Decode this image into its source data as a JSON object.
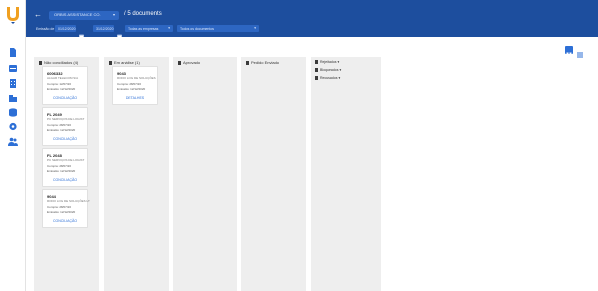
{
  "header": {
    "company": "ORBIS ASSISTANCE CO.",
    "title": "/ 5 documents",
    "filter_label": "Emissão de",
    "date_from": "01/12/2020",
    "to_label": "a",
    "date_to": "31/12/2020",
    "select_one": "Todas as empresas",
    "select_two": "Todos os documentos"
  },
  "columns": [
    {
      "label": "Não conciliados (4)"
    },
    {
      "label": "Em análise (1)"
    },
    {
      "label": "Aprovado"
    },
    {
      "label": "Pedido Enviado"
    }
  ],
  "cards_col1": [
    {
      "title": "6006332",
      "sub": "ALGAR TELECOM S/A",
      "line1": "Compra: 12/07/20",
      "line2": "Emissão: 12/12/2020",
      "link": "CONCILIAÇÃO"
    },
    {
      "title": "FL 2049",
      "sub": "PC SERVIÇOS DE LOGIST",
      "line1": "Compra: 28/07/20",
      "line2": "Emissão: 12/12/2020",
      "link": "CONCILIAÇÃO"
    },
    {
      "title": "FL 2048",
      "sub": "PC SERVIÇOS DE LOGIST",
      "line1": "Compra: 28/07/20",
      "line2": "Emissão: 12/12/2020",
      "link": "CONCILIAÇÃO"
    },
    {
      "title": "9044",
      "sub": "RODO LOG DE SOLUÇÕES LT",
      "line1": "Compra: 28/07/20",
      "line2": "Emissão: 12/12/2020",
      "link": "CONCILIAÇÃO"
    }
  ],
  "cards_col2": [
    {
      "title": "9043",
      "sub": "RODO LOG DE SOLUÇÕES",
      "line1": "Compra: 28/07/20",
      "line2": "Emissão: 12/12/2020",
      "link": "DETALHES"
    }
  ],
  "status_list": [
    {
      "label": "Rejeitados"
    },
    {
      "label": "Bloqueados"
    },
    {
      "label": "Recusados"
    }
  ],
  "icons": {
    "logo": "app-logo",
    "sidebar": [
      "documents-icon",
      "inbox-icon",
      "building-icon",
      "reports-icon",
      "database-icon",
      "settings-icon",
      "users-icon"
    ]
  },
  "colors": {
    "header": "#1d4e9e",
    "field": "#2d66c2",
    "accent": "#2d6fd6",
    "column": "#eeeeee"
  }
}
